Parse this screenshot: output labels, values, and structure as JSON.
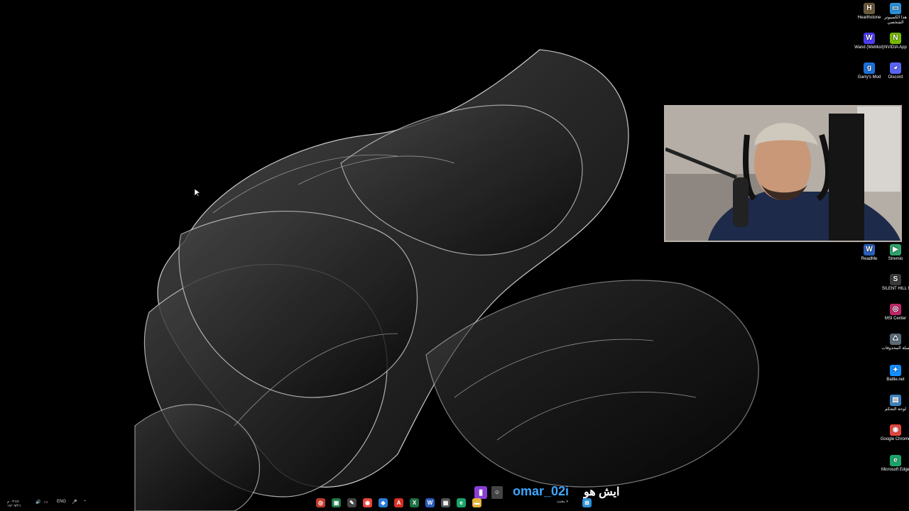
{
  "desktop_icons": [
    {
      "label": "Hearthstone",
      "icon": "hearthstone-icon",
      "color": "#6b5a3a",
      "glyph": "H"
    },
    {
      "label": "هذا الكمبيوتر الشخصي",
      "icon": "this-pc-icon",
      "color": "#2b8fd6",
      "glyph": "▭"
    },
    {
      "label": "Wand (WeMod)",
      "icon": "wand-wemod-icon",
      "color": "#4b3cf0",
      "glyph": "W"
    },
    {
      "label": "NVIDIA App",
      "icon": "nvidia-icon",
      "color": "#76b900",
      "glyph": "N"
    },
    {
      "label": "Garry's Mod",
      "icon": "garrys-mod-icon",
      "color": "#1a6fd9",
      "glyph": "g"
    },
    {
      "label": "Discord",
      "icon": "discord-icon",
      "color": "#5865f2",
      "glyph": "◕"
    },
    {
      "label": "ReadMe",
      "icon": "readme-icon",
      "color": "#2b5fb9",
      "glyph": "W"
    },
    {
      "label": "Stremio",
      "icon": "stremio-icon",
      "color": "#2fa36a",
      "glyph": "▶"
    },
    {
      "label": "SILENT HILL f",
      "icon": "silent-hill-icon",
      "color": "#3a3a3a",
      "glyph": "S"
    },
    {
      "label": "MSI Center",
      "icon": "msi-center-icon",
      "color": "#c0266b",
      "glyph": "◎"
    },
    {
      "label": "سلة المحذوفات",
      "icon": "recycle-bin-icon",
      "color": "#5a6a78",
      "glyph": "♺"
    },
    {
      "label": "Battle.net",
      "icon": "battlenet-icon",
      "color": "#148eff",
      "glyph": "✦"
    },
    {
      "label": "لوحة التحكم",
      "icon": "control-panel-icon",
      "color": "#3b84c7",
      "glyph": "▤"
    },
    {
      "label": "Google Chrome",
      "icon": "chrome-icon",
      "color": "#e8453c",
      "glyph": "◉"
    },
    {
      "label": "Microsoft Edge",
      "icon": "edge-icon",
      "color": "#1aa36a",
      "glyph": "e"
    }
  ],
  "overlay": {
    "handle": "omar_02i",
    "message": "ايش هو",
    "platform_icon": "twitch-icon",
    "badge_icon": "emote-badge-icon"
  },
  "taskbar": {
    "search_label": "بحث",
    "language": "ENG",
    "time": "٠٣:٤٧ م",
    "date": "١٧/٠٩/٢٦",
    "apps": [
      {
        "name": "app-red-circle",
        "color": "#c0392b",
        "glyph": "◎"
      },
      {
        "name": "app-terminal",
        "color": "#1e7b4a",
        "glyph": "▣"
      },
      {
        "name": "app-notepad",
        "color": "#444",
        "glyph": "✎"
      },
      {
        "name": "app-chrome",
        "color": "#e8453c",
        "glyph": "◉"
      },
      {
        "name": "app-3d",
        "color": "#2d7ad6",
        "glyph": "◆"
      },
      {
        "name": "app-acrobat",
        "color": "#d93025",
        "glyph": "A"
      },
      {
        "name": "app-excel",
        "color": "#1d7044",
        "glyph": "X"
      },
      {
        "name": "app-word",
        "color": "#2b5fb9",
        "glyph": "W"
      },
      {
        "name": "app-calendar",
        "color": "#555",
        "glyph": "▦"
      },
      {
        "name": "app-edge",
        "color": "#1aa36a",
        "glyph": "e"
      },
      {
        "name": "app-explorer",
        "color": "#e2b23a",
        "glyph": "▬"
      }
    ]
  }
}
